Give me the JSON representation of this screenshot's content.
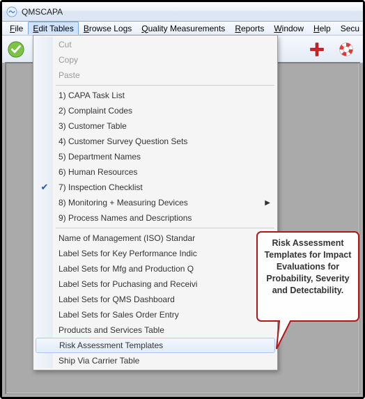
{
  "window": {
    "title": "QMSCAPA"
  },
  "menubar": {
    "file": "File",
    "edit_tables": "Edit Tables",
    "browse_logs": "Browse Logs",
    "quality_measurements": "Quality Measurements",
    "reports": "Reports",
    "window": "Window",
    "help": "Help",
    "security": "Secu"
  },
  "dropdown": {
    "cut": "Cut",
    "copy": "Copy",
    "paste": "Paste",
    "item1": "1) CAPA Task List",
    "item2": "2) Complaint Codes",
    "item3": "3) Customer Table",
    "item4": "4) Customer Survey Question Sets",
    "item5": "5) Department Names",
    "item6": "6) Human Resources",
    "item7": "7) Inspection Checklist",
    "item8": "8) Monitoring + Measuring Devices",
    "item9": "9) Process Names and Descriptions",
    "item10": "Name of Management (ISO) Standar",
    "item11": "Label Sets for Key Performance Indic",
    "item12": "Label Sets for Mfg and Production Q",
    "item13": "Label Sets for Puchasing and Receivi",
    "item14": "Label Sets for QMS Dashboard",
    "item15": "Label Sets for Sales Order Entry",
    "item16": "Products and Services Table",
    "item17": "Risk Assessment Templates",
    "item18": "Ship Via Carrier Table"
  },
  "callout": {
    "text": "Risk Assessment Templates for Impact Evaluations for Probability, Severity and Detectability."
  }
}
